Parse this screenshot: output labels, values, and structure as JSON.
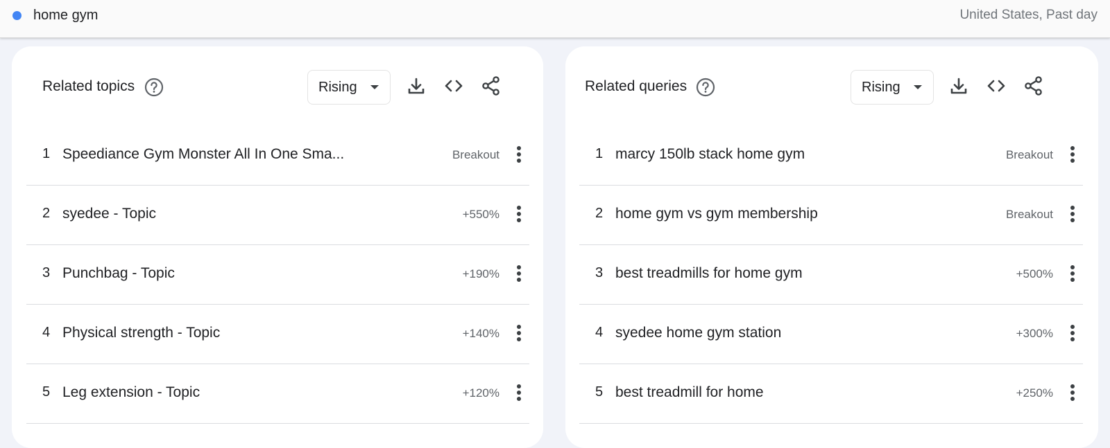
{
  "header": {
    "term": "home gym",
    "term_color": "#4285f4",
    "scope": "United States, Past day"
  },
  "topics": {
    "title": "Related topics",
    "filter": "Rising",
    "items": [
      {
        "rank": "1",
        "label": "Speediance Gym Monster All In One Sma...",
        "value": "Breakout"
      },
      {
        "rank": "2",
        "label": "syedee - Topic",
        "value": "+550%"
      },
      {
        "rank": "3",
        "label": "Punchbag - Topic",
        "value": "+190%"
      },
      {
        "rank": "4",
        "label": "Physical strength - Topic",
        "value": "+140%"
      },
      {
        "rank": "5",
        "label": "Leg extension - Topic",
        "value": "+120%"
      }
    ]
  },
  "queries": {
    "title": "Related queries",
    "filter": "Rising",
    "items": [
      {
        "rank": "1",
        "label": "marcy 150lb stack home gym",
        "value": "Breakout"
      },
      {
        "rank": "2",
        "label": "home gym vs gym membership",
        "value": "Breakout"
      },
      {
        "rank": "3",
        "label": "best treadmills for home gym",
        "value": "+500%"
      },
      {
        "rank": "4",
        "label": "syedee home gym station",
        "value": "+300%"
      },
      {
        "rank": "5",
        "label": "best treadmill for home",
        "value": "+250%"
      }
    ]
  },
  "icons": {
    "help": "help-circle-icon",
    "download": "download-icon",
    "embed": "code-embed-icon",
    "share": "share-icon",
    "more": "more-vert-icon",
    "dropdown": "caret-down-icon"
  }
}
